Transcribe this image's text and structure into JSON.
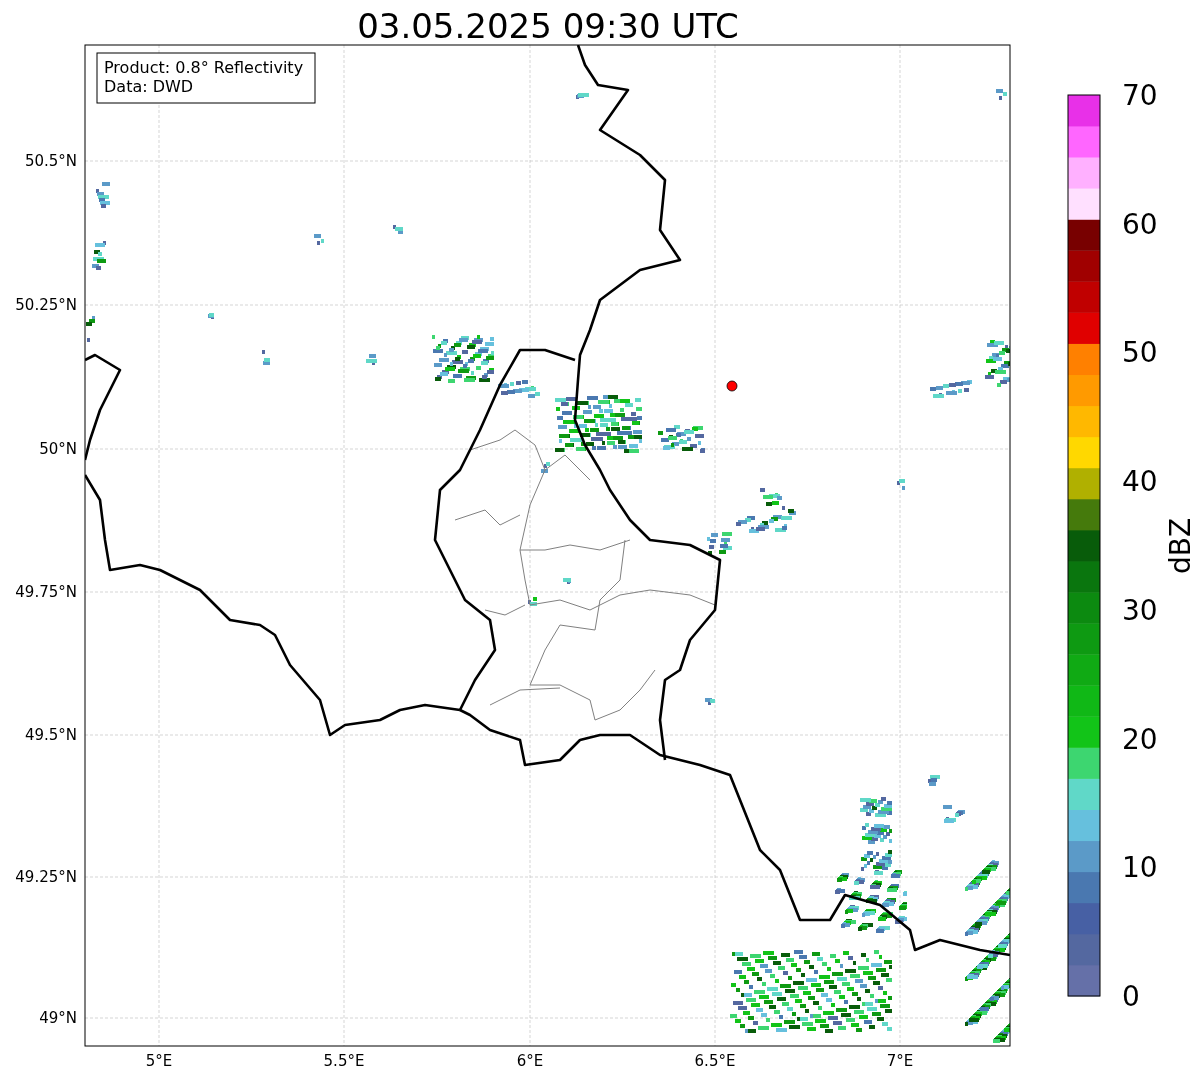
{
  "title": "03.05.2025 09:30 UTC",
  "legend": [
    "Product: 0.8° Reflectivity",
    "Data: DWD"
  ],
  "x_ticks": [
    "5°E",
    "5.5°E",
    "6°E",
    "6.5°E",
    "7°E"
  ],
  "y_ticks": [
    "50.5°N",
    "50.25°N",
    "50°N",
    "49.75°N",
    "49.5°N",
    "49.25°N",
    "49°N"
  ],
  "colorbar": {
    "label": "dBZ",
    "ticks": [
      "70",
      "60",
      "50",
      "40",
      "30",
      "20",
      "10",
      "0"
    ],
    "segments": [
      {
        "color": "#6570a8"
      },
      {
        "color": "#5468a0"
      },
      {
        "color": "#4760a4"
      },
      {
        "color": "#4a78b0"
      },
      {
        "color": "#5b9ac8"
      },
      {
        "color": "#66c0dd"
      },
      {
        "color": "#60d8c8"
      },
      {
        "color": "#3dd670"
      },
      {
        "color": "#12c418"
      },
      {
        "color": "#10b816"
      },
      {
        "color": "#10aa14"
      },
      {
        "color": "#0e9a12"
      },
      {
        "color": "#0c8a10"
      },
      {
        "color": "#0a760e"
      },
      {
        "color": "#085c0a"
      },
      {
        "color": "#457a0c"
      },
      {
        "color": "#b0b000"
      },
      {
        "color": "#ffd800"
      },
      {
        "color": "#ffb800"
      },
      {
        "color": "#ff9a00"
      },
      {
        "color": "#ff8000"
      },
      {
        "color": "#e00000"
      },
      {
        "color": "#c00000"
      },
      {
        "color": "#a00000"
      },
      {
        "color": "#780000"
      },
      {
        "color": "#ffe0ff"
      },
      {
        "color": "#ffb0ff"
      },
      {
        "color": "#ff66ff"
      },
      {
        "color": "#e830e8"
      }
    ]
  }
}
